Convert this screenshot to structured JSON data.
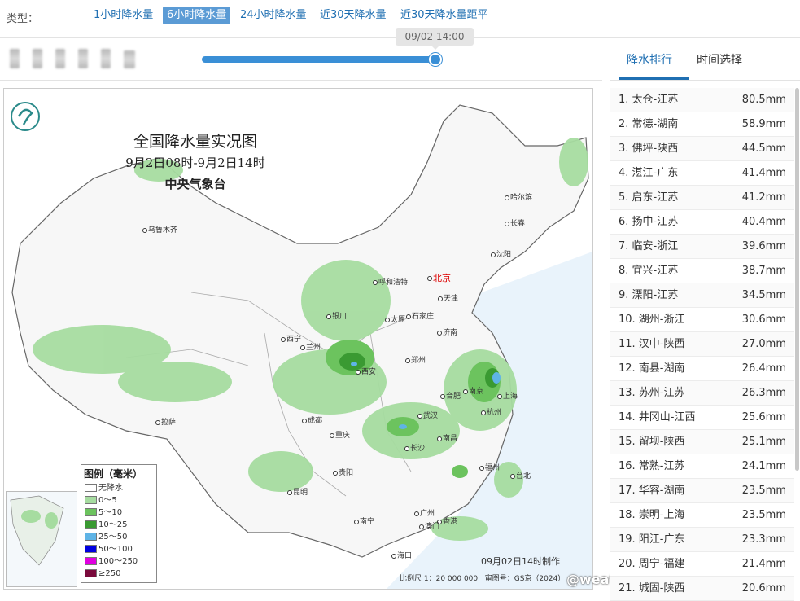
{
  "type_bar": {
    "label": "类型：",
    "options": [
      "1小时降水量",
      "6小时降水量",
      "24小时降水量",
      "近30天降水量",
      "近30天降水量距平"
    ],
    "active_index": 1
  },
  "timeline": {
    "tooltip": "09/02 14:00",
    "progress": 1.0
  },
  "map": {
    "title": "全国降水量实况图",
    "subtitle": "9月2日08时-9月2日14时",
    "agency": "中央气象台",
    "cities": [
      {
        "name": "乌鲁木齐"
      },
      {
        "name": "哈尔滨"
      },
      {
        "name": "长春"
      },
      {
        "name": "沈阳"
      },
      {
        "name": "呼和浩特"
      },
      {
        "name": "北京"
      },
      {
        "name": "天津"
      },
      {
        "name": "银川"
      },
      {
        "name": "太原"
      },
      {
        "name": "石家庄"
      },
      {
        "name": "济南"
      },
      {
        "name": "西宁"
      },
      {
        "name": "兰州"
      },
      {
        "name": "西安"
      },
      {
        "name": "郑州"
      },
      {
        "name": "合肥"
      },
      {
        "name": "南京"
      },
      {
        "name": "上海"
      },
      {
        "name": "武汉"
      },
      {
        "name": "杭州"
      },
      {
        "name": "拉萨"
      },
      {
        "name": "成都"
      },
      {
        "name": "重庆"
      },
      {
        "name": "长沙"
      },
      {
        "name": "南昌"
      },
      {
        "name": "福州"
      },
      {
        "name": "台北"
      },
      {
        "name": "贵阳"
      },
      {
        "name": "昆明"
      },
      {
        "name": "南宁"
      },
      {
        "name": "广州"
      },
      {
        "name": "香港"
      },
      {
        "name": "澳门"
      },
      {
        "name": "海口"
      }
    ],
    "legend": {
      "title": "图例（毫米）",
      "items": [
        {
          "label": "无降水",
          "color": "#ffffff"
        },
        {
          "label": "0～5",
          "color": "#a6dca0"
        },
        {
          "label": "5～10",
          "color": "#6cc35e"
        },
        {
          "label": "10～25",
          "color": "#3a9a32"
        },
        {
          "label": "25～50",
          "color": "#5fb4e6"
        },
        {
          "label": "50～100",
          "color": "#0000e0"
        },
        {
          "label": "100～250",
          "color": "#e000e0"
        },
        {
          "label": "≥250",
          "color": "#7a0a3c"
        }
      ]
    },
    "made_time": "09月02日14时制作",
    "scale": "比例尺 1：20 000 000",
    "review_no": "审图号：GS京（2024）"
  },
  "watermark": "@weatherman_信欣",
  "panel": {
    "tabs": [
      "降水排行",
      "时间选择"
    ],
    "active_tab": 0,
    "ranking": [
      {
        "name": "1. 太仓-江苏",
        "value": "80.5mm"
      },
      {
        "name": "2. 常德-湖南",
        "value": "58.9mm"
      },
      {
        "name": "3. 佛坪-陕西",
        "value": "44.5mm"
      },
      {
        "name": "4. 湛江-广东",
        "value": "41.4mm"
      },
      {
        "name": "5. 启东-江苏",
        "value": "41.2mm"
      },
      {
        "name": "6. 扬中-江苏",
        "value": "40.4mm"
      },
      {
        "name": "7. 临安-浙江",
        "value": "39.6mm"
      },
      {
        "name": "8. 宜兴-江苏",
        "value": "38.7mm"
      },
      {
        "name": "9. 溧阳-江苏",
        "value": "34.5mm"
      },
      {
        "name": "10. 湖州-浙江",
        "value": "30.6mm"
      },
      {
        "name": "11. 汉中-陕西",
        "value": "27.0mm"
      },
      {
        "name": "12. 南县-湖南",
        "value": "26.4mm"
      },
      {
        "name": "13. 苏州-江苏",
        "value": "26.3mm"
      },
      {
        "name": "14. 井冈山-江西",
        "value": "25.6mm"
      },
      {
        "name": "15. 留坝-陕西",
        "value": "25.1mm"
      },
      {
        "name": "16. 常熟-江苏",
        "value": "24.1mm"
      },
      {
        "name": "17. 华容-湖南",
        "value": "23.5mm"
      },
      {
        "name": "18. 崇明-上海",
        "value": "23.5mm"
      },
      {
        "name": "19. 阳江-广东",
        "value": "23.3mm"
      },
      {
        "name": "20. 周宁-福建",
        "value": "21.4mm"
      },
      {
        "name": "21. 城固-陕西",
        "value": "20.6mm"
      }
    ]
  }
}
